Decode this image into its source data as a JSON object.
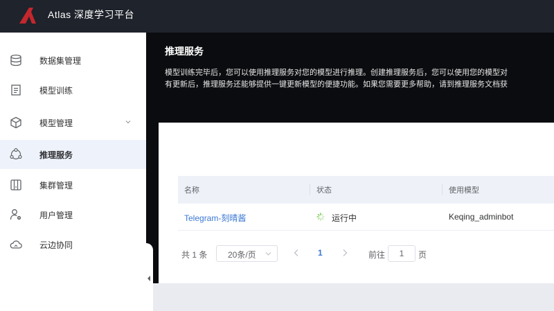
{
  "app": {
    "title": "Atlas 深度学习平台",
    "brand_color": "#c4272d"
  },
  "sidebar": {
    "items": [
      {
        "label": "数据集管理",
        "icon": "database-icon"
      },
      {
        "label": "模型训练",
        "icon": "document-icon"
      },
      {
        "label": "模型管理",
        "icon": "cube-icon",
        "expandable": true
      },
      {
        "label": "推理服务",
        "icon": "network-icon",
        "active": true
      },
      {
        "label": "集群管理",
        "icon": "server-icon"
      },
      {
        "label": "用户管理",
        "icon": "user-gear-icon"
      },
      {
        "label": "云边协同",
        "icon": "cloud-icon"
      }
    ]
  },
  "banner": {
    "title": "推理服务",
    "desc_line1": "模型训练完毕后，您可以使用推理服务对您的模型进行推理。创建推理服务后，您可以使用您的模型对",
    "desc_line2": "有更新后，推理服务还能够提供一键更新模型的便捷功能。如果您需要更多帮助，请到推理服务文档获"
  },
  "table": {
    "columns": [
      "名称",
      "状态",
      "使用模型"
    ],
    "rows": [
      {
        "name": "Telegram-刻晴酱",
        "status": "运行中",
        "model": "Keqing_adminbot"
      }
    ]
  },
  "pagination": {
    "total": "共 1 条",
    "page_size": "20条/页",
    "current_page": "1",
    "goto_label": "前往",
    "goto_value": "1",
    "page_suffix": "页"
  },
  "colors": {
    "accent": "#3a78d4",
    "active_bg": "#eef3fb",
    "topbar": "#1f232b",
    "status_running": "#67c23a"
  }
}
